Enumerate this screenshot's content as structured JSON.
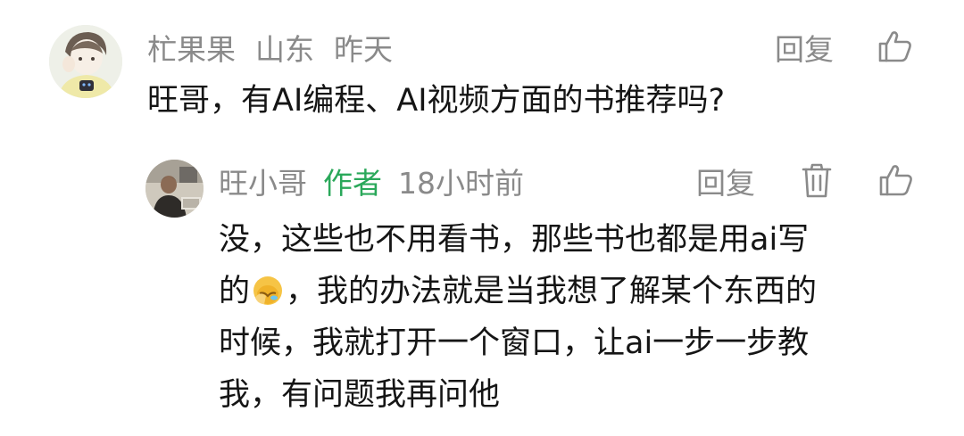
{
  "top_comment": {
    "username": "杧果果",
    "location": "山东",
    "time": "昨天",
    "text": "旺哥，有AI编程、AI视频方面的书推荐吗?",
    "reply_label": "回复",
    "like_icon": "thumbs-up-icon",
    "avatar": "user-avatar"
  },
  "reply_comment": {
    "username": "旺小哥",
    "badge": "作者",
    "time": "18小时前",
    "reply_label": "回复",
    "delete_icon": "trash-icon",
    "like_icon": "thumbs-up-icon",
    "avatar": "author-avatar",
    "text_lines": [
      "没，这些也不用看书，那些书也都是用ai写",
      "的",
      "，我的办法就是当我想了解某个东西的",
      "时候，我就打开一个窗口，让ai一步一步教",
      "我，有问题我再问他"
    ],
    "emoji": "facepalm-laughing-emoji"
  },
  "colors": {
    "text": "#151515",
    "meta": "#8a8a8a",
    "author_badge": "#2aa85a",
    "background": "#ffffff"
  }
}
